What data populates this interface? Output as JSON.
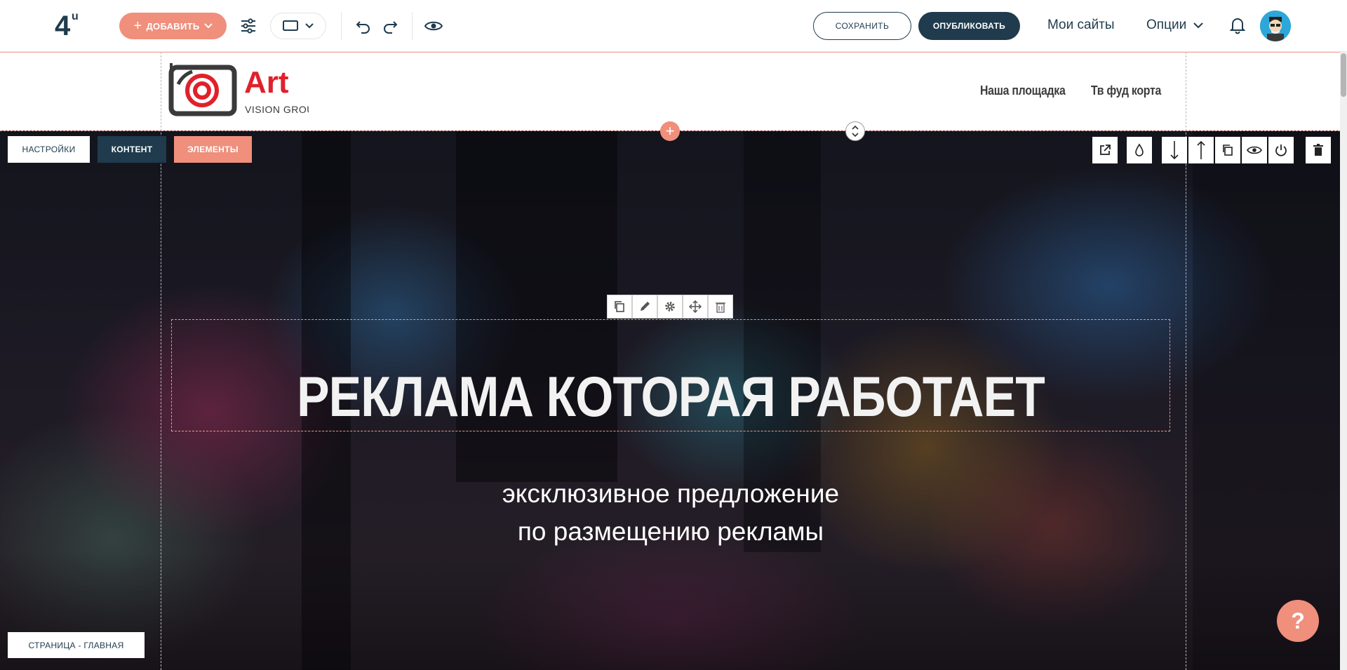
{
  "toolbar": {
    "add_label": "ДОБАВИТЬ",
    "save_label": "СОХРАНИТЬ",
    "publish_label": "ОПУБЛИКОВАТЬ",
    "my_sites_label": "Мои сайты",
    "options_label": "Опции"
  },
  "site": {
    "nav": [
      "Наша площадка",
      "Тв фуд корта"
    ]
  },
  "section_tabs": {
    "settings": "НАСТРОЙКИ",
    "content": "КОНТЕНТ",
    "elements": "ЭЛЕМЕНТЫ"
  },
  "hero": {
    "title": "РЕКЛАМА КОТОРАЯ РАБОТАЕТ",
    "subtitle_line1": "эксклюзивное предложение",
    "subtitle_line2": "по размещению рекламы"
  },
  "page_label": "СТРАНИЦА - ГЛАВНАЯ",
  "help_label": "?",
  "colors": {
    "accent": "#ef8f7c",
    "dark": "#1f3b4d",
    "logo_red": "#e0212b"
  }
}
